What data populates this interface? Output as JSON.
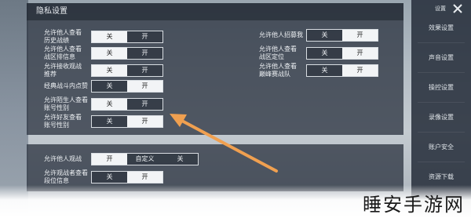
{
  "panel_title": "隐私设置",
  "toggle_on": "开",
  "toggle_off": "关",
  "custom": "自定义",
  "left_settings": [
    {
      "label": "允许他人查看\n历史战绩",
      "state": "off"
    },
    {
      "label": "允许他人查看\n战区排信息",
      "state": "off"
    },
    {
      "label": "允许接收观战\n推荐",
      "state": "off"
    },
    {
      "label": "经典战斗内点赞",
      "state": "on"
    },
    {
      "label": "允许陌生人查看\n账号性别",
      "state": "off"
    },
    {
      "label": "允许好友查看\n账号性别",
      "state": "on"
    }
  ],
  "right_settings": [
    {
      "label": "允许他人招募我",
      "state": "on"
    },
    {
      "label": "允许他人查看\n战区定位",
      "state": "on"
    },
    {
      "label": "允许他人查看\n巅峰赛战队",
      "state": "on"
    }
  ],
  "bottom_settings": [
    {
      "label": "允许他人观战",
      "state": "on"
    },
    {
      "label": "允许观战者查看\n段位信息",
      "state": "on"
    }
  ],
  "sidebar": {
    "header_label": "设置",
    "items": [
      "效果设置",
      "声音设置",
      "操控设置",
      "录像设置",
      "账户安全",
      "资源下载"
    ]
  },
  "watermark": "睡安手游网",
  "colors": {
    "arrow": "#f0a050",
    "toggle_on_bg": "#f2f4f6",
    "panel_bg": "#2e3642"
  }
}
